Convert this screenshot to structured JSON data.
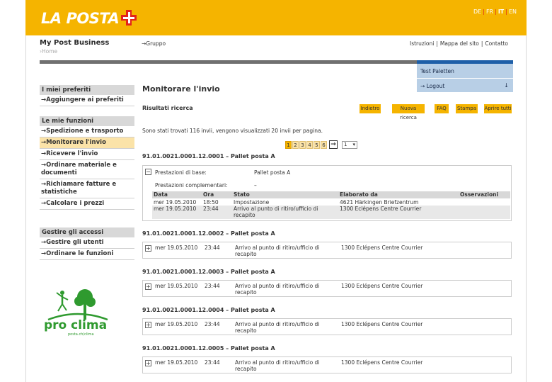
{
  "header": {
    "logo_text": "LA POSTA",
    "languages": [
      "DE",
      "FR",
      "IT",
      "EN"
    ],
    "active_language": "IT",
    "accent_color": "#f5b400",
    "cross_color": "#e2231a"
  },
  "subheader": {
    "brand": "My Post Business",
    "home_crumb": "›Home",
    "gruppo": "→Gruppo",
    "links": [
      "Istruzioni",
      "Mappa del sito",
      "Contatto"
    ]
  },
  "user_panel": {
    "name": "Test Paletten",
    "logout": "→ Logout",
    "logout_icon": "arrow-down-icon"
  },
  "sidebar": {
    "section1_title": "I miei preferiti",
    "section1_items": [
      "→Aggiungere ai preferiti"
    ],
    "section2_title": "Le mie funzioni",
    "section2_items": [
      "→Spedizione e trasporto",
      "→Monitorare l'invio",
      "→Ricevere l'invio",
      "→Ordinare materiale e documenti",
      "→Richiamare fatture e statistiche",
      "→Calcolare i prezzi"
    ],
    "active_item": "→Monitorare l'invio",
    "section3_title": "Gestire gli accessi",
    "section3_items": [
      "→Gestire gli utenti",
      "→Ordinare le funzioni"
    ],
    "proclima_text": "pro clima",
    "proclima_sub": "posta.ch/clima"
  },
  "main": {
    "title": "Monitorare l'invio",
    "results_label": "Risultati ricerca",
    "buttons": [
      "Indietro",
      "Nuova ricerca",
      "FAQ",
      "Stampa",
      "Aprire tutti"
    ],
    "info": "Sono stati trovati 116 invii, vengono visualizzati 20 invii per pagina.",
    "pages": [
      "1",
      "2",
      "3",
      "4",
      "5",
      "6"
    ],
    "current_page": "1",
    "page_select": "1",
    "next_icon": "arrow-right-icon"
  },
  "shipment1": {
    "title": "91.01.0021.0001.12.0001 – Pallet posta A",
    "toggle": "−",
    "base_label": "Prestazioni di base:",
    "base_value": "Pallet posta A",
    "compl_label": "Prestazioni complementari:",
    "compl_value": "–",
    "columns": [
      "Data",
      "Ora",
      "Stato",
      "Elaborato da",
      "Osservazioni"
    ],
    "rows": [
      {
        "data": "mer 19.05.2010",
        "ora": "18:50",
        "stato": "Impostazione",
        "elaborato": "4621 Härkingen Briefzentrum"
      },
      {
        "data": "mer 19.05.2010",
        "ora": "23:44",
        "stato": "Arrivo al punto di ritiro/ufficio di recapito",
        "elaborato": "1300 Eclépens Centre Courrier"
      }
    ]
  },
  "shipments": [
    {
      "title": "91.01.0021.0001.12.0002 – Pallet posta A",
      "toggle": "+",
      "data": "mer 19.05.2010",
      "ora": "23:44",
      "stato": "Arrivo al punto di ritiro/ufficio di recapito",
      "elaborato": "1300 Eclépens Centre Courrier"
    },
    {
      "title": "91.01.0021.0001.12.0003 – Pallet posta A",
      "toggle": "+",
      "data": "mer 19.05.2010",
      "ora": "23:44",
      "stato": "Arrivo al punto di ritiro/ufficio di recapito",
      "elaborato": "1300 Eclépens Centre Courrier"
    },
    {
      "title": "91.01.0021.0001.12.0004 – Pallet posta A",
      "toggle": "+",
      "data": "mer 19.05.2010",
      "ora": "23:44",
      "stato": "Arrivo al punto di ritiro/ufficio di recapito",
      "elaborato": "1300 Eclépens Centre Courrier"
    },
    {
      "title": "91.01.0021.0001.12.0005 – Pallet posta A",
      "toggle": "+",
      "data": "mer 19.05.2010",
      "ora": "23:44",
      "stato": "Arrivo al punto di ritiro/ufficio di recapito",
      "elaborato": "1300 Eclépens Centre Courrier"
    }
  ]
}
